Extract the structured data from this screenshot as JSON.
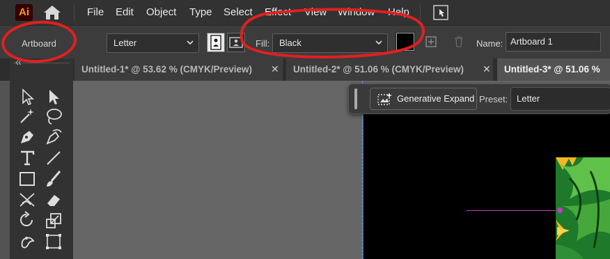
{
  "app": {
    "logo_text": "Ai",
    "accent": "#ff9a00",
    "annotation_color": "#e02020"
  },
  "menu": [
    "File",
    "Edit",
    "Object",
    "Type",
    "Select",
    "Effect",
    "View",
    "Window",
    "Help"
  ],
  "control": {
    "mode_label": "Artboard",
    "preset_value": "Letter",
    "fill_label": "Fill:",
    "fill_value": "Black",
    "fill_color": "#000000",
    "name_label": "Name:",
    "name_value": "Artboard 1"
  },
  "tabs": [
    {
      "title": "Untitled-1* @ 53.62 % (CMYK/Preview)",
      "close": "✕"
    },
    {
      "title": "Untitled-2* @ 51.06 % (CMYK/Preview)",
      "close": "✕"
    },
    {
      "title": "Untitled-3* @ 51.06 %"
    }
  ],
  "contextual_bar": {
    "generative_label": "Generative Expand",
    "preset_label": "Preset:",
    "preset_value": "Letter"
  },
  "tools": [
    "direct-selection",
    "selection",
    "magic-wand",
    "lasso",
    "pen",
    "curvature",
    "type",
    "line-segment",
    "rectangle",
    "paintbrush",
    "shaper",
    "eraser",
    "rotate",
    "scale",
    "puppet-warp",
    "free-transform"
  ]
}
